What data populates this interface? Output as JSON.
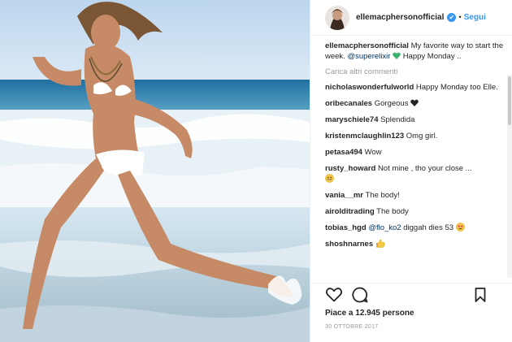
{
  "post": {
    "username": "ellemacphersonofficial",
    "follow_separator": "•",
    "follow_label": "Segui",
    "verified_badge": "✔",
    "caption": {
      "user": "ellemacphersonofficial",
      "text_before": "My favorite way to start the week.",
      "mention": "@superelixir",
      "text_after": "Happy Monday .."
    },
    "load_more_label": "Carica altri commenti",
    "comments": [
      {
        "user": "nicholaswonderfulworld",
        "text": "Happy Monday too Elle."
      },
      {
        "user": "oribecanales",
        "text": "Gorgeous"
      },
      {
        "user": "maryschiele74",
        "text": "Splendida"
      },
      {
        "user": "kristenmclaughlin123",
        "text": "Omg girl."
      },
      {
        "user": "petasa494",
        "text": "Wow"
      },
      {
        "user": "rusty_howard",
        "text": "Not mine , tho your close ..."
      },
      {
        "user": "vania__mr",
        "text": "The body!"
      },
      {
        "user": "airolditrading",
        "text": "The body"
      },
      {
        "user": "tobias_hgd",
        "mention": "@flo_ko2",
        "text": "diggah dies 53"
      },
      {
        "user": "shoshnarnes",
        "text": ""
      }
    ],
    "likes_text": "Piace a 12.945 persone",
    "date": "30 OTTOBRE 2017"
  },
  "colors": {
    "link": "#3897f0",
    "mention": "#003569",
    "muted": "#999999",
    "green_heart": "#3cb371"
  },
  "icons": [
    "heart-icon",
    "comment-icon",
    "bookmark-icon",
    "verified-icon"
  ]
}
